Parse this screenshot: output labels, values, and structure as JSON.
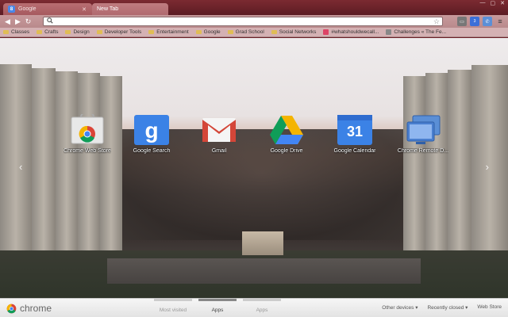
{
  "tabs": [
    {
      "label": "Google",
      "favicon": "google-g",
      "close": "✕"
    },
    {
      "label": "New Tab"
    }
  ],
  "toolbar": {
    "back": "◀",
    "forward": "▶",
    "reload": "↻",
    "omnibox_value": "",
    "search_icon": "🔍",
    "star_icon": "☆",
    "extensions": [
      "screen",
      "chrome-extension",
      "phone",
      "wrench-menu"
    ],
    "extension_badge": "3"
  },
  "bookmarks": [
    {
      "label": "Classes",
      "type": "folder"
    },
    {
      "label": "Crafts",
      "type": "folder"
    },
    {
      "label": "Design",
      "type": "folder"
    },
    {
      "label": "Developer Tools",
      "type": "folder"
    },
    {
      "label": "Entertainment",
      "type": "folder"
    },
    {
      "label": "Google",
      "type": "folder"
    },
    {
      "label": "Grad School",
      "type": "folder"
    },
    {
      "label": "Social Networks",
      "type": "folder"
    },
    {
      "label": "#whatshouldwecall...",
      "type": "site"
    },
    {
      "label": "Challenges « The Fe...",
      "type": "site"
    }
  ],
  "apps": [
    {
      "label": "Chrome Web Store",
      "icon": "chrome-web-store-icon"
    },
    {
      "label": "Google Search",
      "icon": "google-search-icon"
    },
    {
      "label": "Gmail",
      "icon": "gmail-icon"
    },
    {
      "label": "Google Drive",
      "icon": "google-drive-icon"
    },
    {
      "label": "Google Calendar",
      "icon": "google-calendar-icon",
      "day": "31"
    },
    {
      "label": "Chrome Remote D...",
      "icon": "chrome-remote-desktop-icon"
    }
  ],
  "nav_arrows": {
    "left": "‹",
    "right": "›"
  },
  "bottom": {
    "brand": "chrome",
    "pages": [
      {
        "label": "Most visited",
        "selected": false
      },
      {
        "label": "Apps",
        "selected": true
      },
      {
        "label": "Apps",
        "selected": false
      }
    ],
    "other_devices": "Other devices ▾",
    "recently_closed": "Recently closed ▾",
    "web_store": "Web Store"
  },
  "colors": {
    "theme_frame": "#6d2028",
    "gmail_red": "#d44638",
    "google_blue": "#4285f4"
  }
}
